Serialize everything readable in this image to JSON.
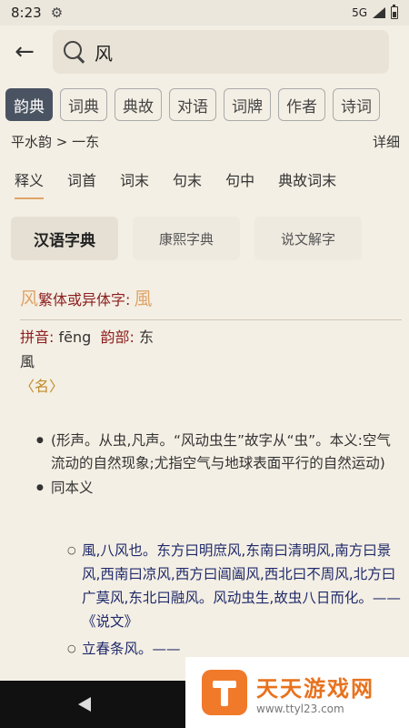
{
  "status": {
    "time": "8:23",
    "network": "5G"
  },
  "search": {
    "value": "风"
  },
  "categories": [
    "韵典",
    "词典",
    "典故",
    "对语",
    "词牌",
    "作者",
    "诗词"
  ],
  "breadcrumb": {
    "path": "平水韵 > 一东",
    "detail": "详细"
  },
  "sub_tabs": [
    "释义",
    "词首",
    "词末",
    "句末",
    "句中",
    "典故词末"
  ],
  "dict_tabs": [
    "汉语字典",
    "康熙字典",
    "说文解字"
  ],
  "entry": {
    "char": "风",
    "variant_label": "繁体或异体字:",
    "variant": "風",
    "pinyin_label": "拼音:",
    "pinyin": "fēng",
    "rhyme_label": "韵部:",
    "rhyme": "东",
    "trad": "風",
    "pos": "〈名〉"
  },
  "definitions": [
    "(形声。从虫,凡声。“风动虫生”故字从“虫”。本义:空气流动的自然现象;尤指空气与地球表面平行的自然运动)",
    "同本义"
  ],
  "examples": [
    "風,八风也。东方曰明庶风,东南曰清明风,南方曰景风,西南曰凉风,西方曰阊阖风,西北曰不周风,北方曰广莫风,东北曰融风。风动虫生,故虫八日而化。——《说文》",
    "立春条风。——"
  ],
  "watermark": {
    "name": "天天游戏网",
    "url": "www.ttyl23.com"
  }
}
